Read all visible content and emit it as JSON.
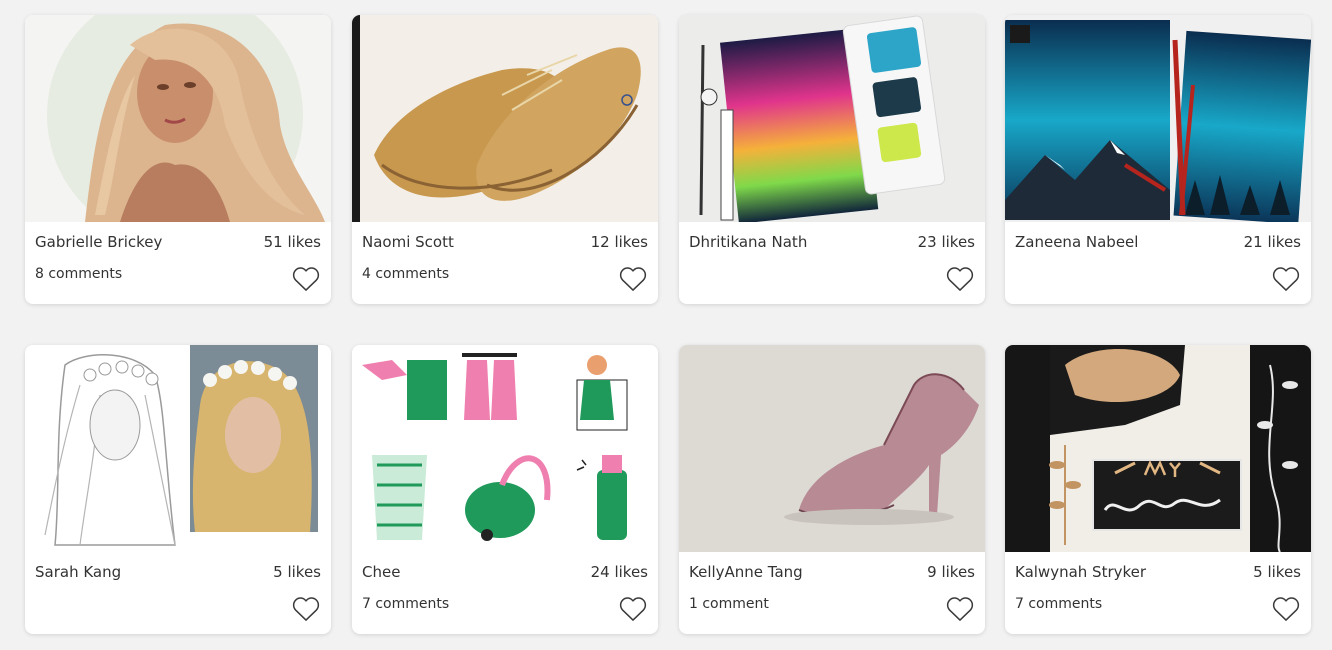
{
  "accent": "#ffffff",
  "heart_icon": "heart-outline-icon",
  "cards": [
    {
      "author": "Gabrielle Brickey",
      "likes": "51 likes",
      "comments": "8 comments",
      "art": "blonde-woman-portrait"
    },
    {
      "author": "Naomi Scott",
      "likes": "12 likes",
      "comments": "4 comments",
      "art": "brown-brogue-shoes"
    },
    {
      "author": "Dhritikana Nath",
      "likes": "23 likes",
      "comments": "",
      "art": "aurora-watercolor-with-palette"
    },
    {
      "author": "Zaneena Nabeel",
      "likes": "21 likes",
      "comments": "",
      "art": "aurora-mountain-paintings"
    },
    {
      "author": "Sarah Kang",
      "likes": "5 likes",
      "comments": "",
      "art": "flower-crown-sketch-and-photo"
    },
    {
      "author": "Chee",
      "likes": "24 likes",
      "comments": "7 comments",
      "art": "spring-clean-illustrations"
    },
    {
      "author": "KellyAnne Tang",
      "likes": "9 likes",
      "comments": "1 comment",
      "art": "glitter-high-heel"
    },
    {
      "author": "Kalwynah Stryker",
      "likes": "5 likes",
      "comments": "7 comments",
      "art": "my-soulmate-collage"
    }
  ]
}
